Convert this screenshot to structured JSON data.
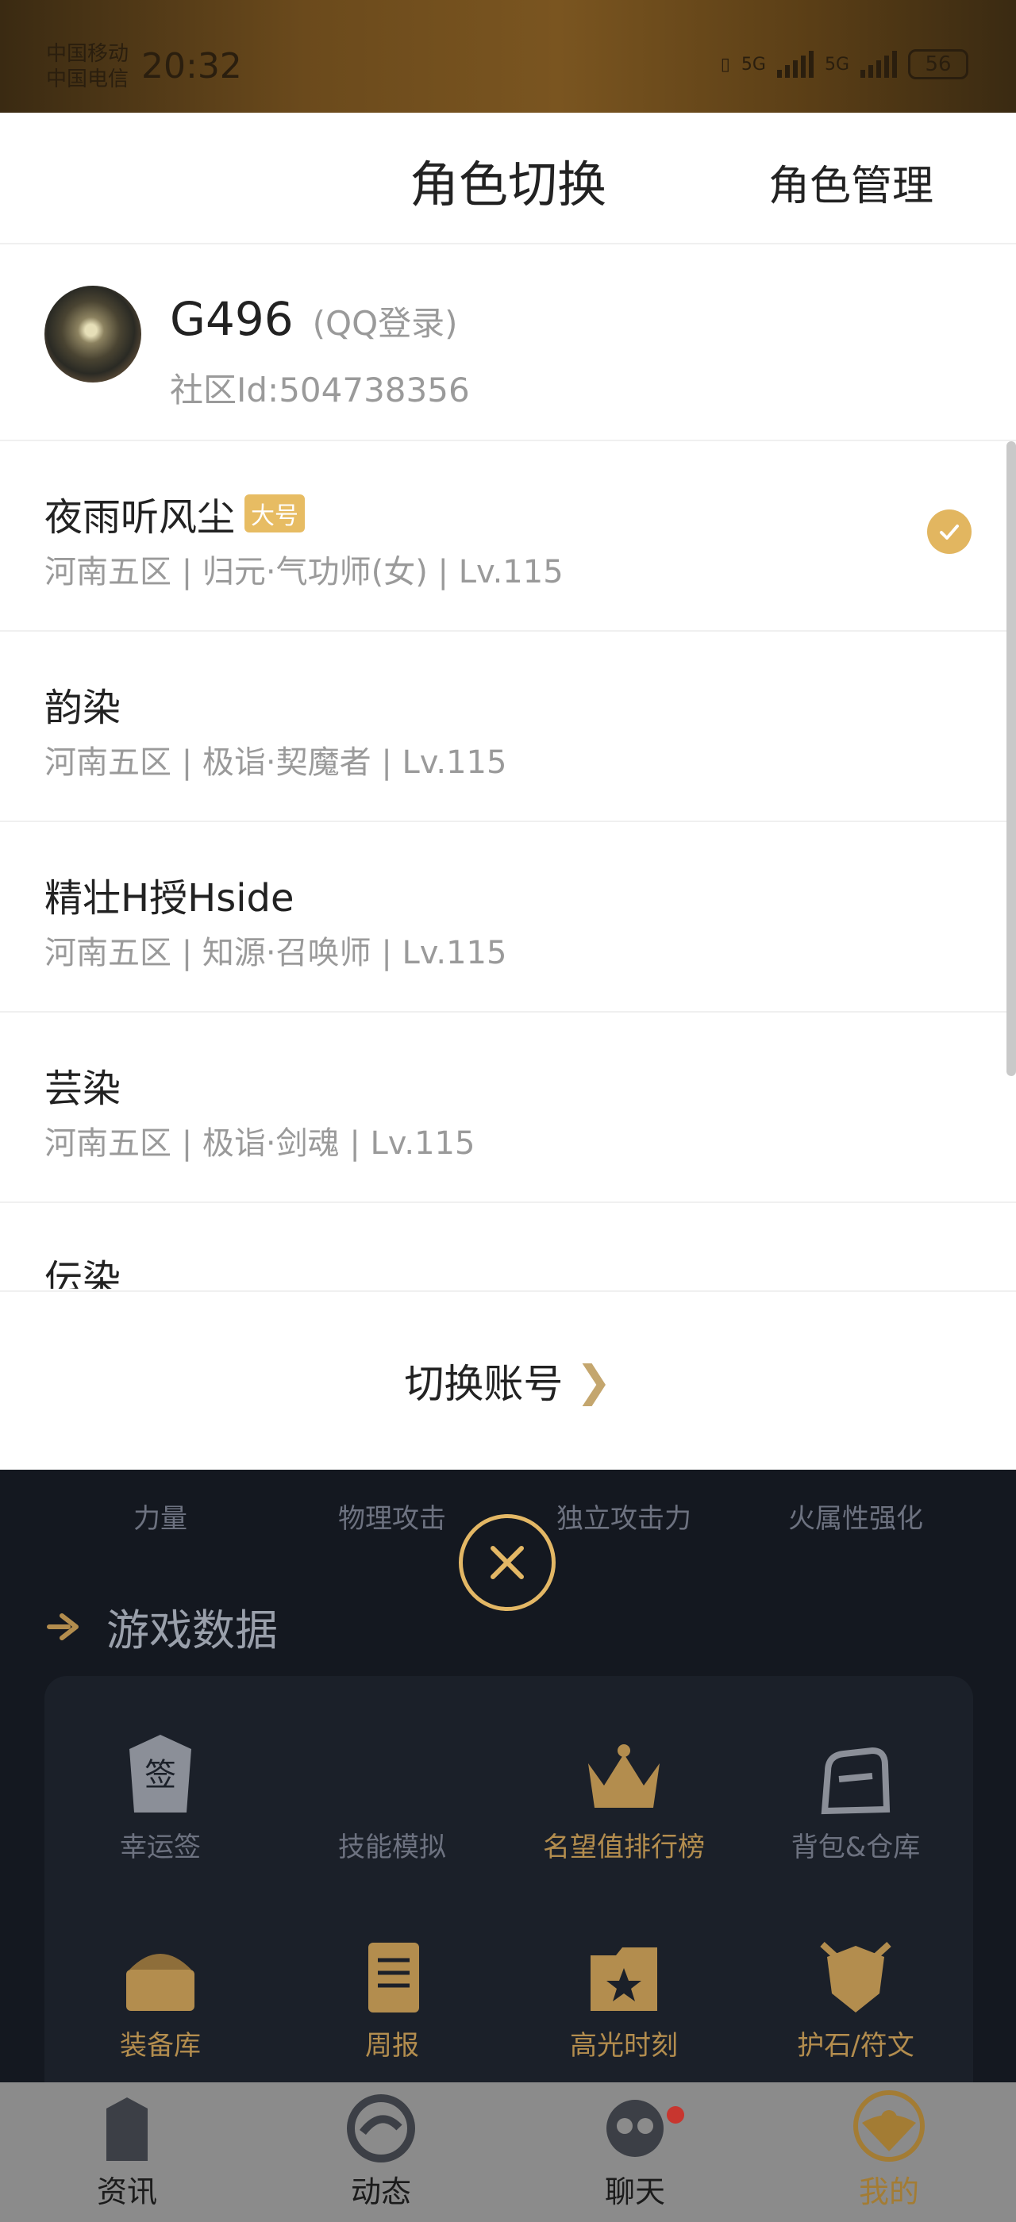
{
  "status": {
    "carrier1": "中国移动",
    "carrier2": "中国电信",
    "time": "20:32",
    "battery": "56",
    "net1": "5G",
    "net2": "5G"
  },
  "sheet": {
    "title": "角色切换",
    "manage_label": "角色管理"
  },
  "account": {
    "name": "G496",
    "login": "(QQ登录)",
    "community_id": "社区Id:504738356"
  },
  "roles": [
    {
      "name": "夜雨听风尘",
      "badge": "大号",
      "meta": "河南五区 | 归元·气功师(女) | Lv.115"
    },
    {
      "name": "韵染",
      "meta": "河南五区 | 极诣·契魔者 | Lv.115"
    },
    {
      "name": "精壮H授Hside",
      "meta": "河南五区 | 知源·召唤师 | Lv.115"
    },
    {
      "name": "芸染",
      "meta": "河南五区 | 极诣·剑魂 | Lv.115"
    },
    {
      "name": "伝染",
      "meta": ""
    }
  ],
  "switch_account": "切换账号",
  "stats": [
    "力量",
    "物理攻击",
    "独立攻击力",
    "火属性强化"
  ],
  "game_data": {
    "title": "游戏数据",
    "tiles": [
      "幸运签",
      "技能模拟",
      "名望值排行榜",
      "背包&仓库",
      "装备库",
      "周报",
      "高光时刻",
      "护石/符文"
    ]
  },
  "nav": [
    "资讯",
    "动态",
    "聊天",
    "我的"
  ],
  "colors": {
    "accent": "#e2b660",
    "badge": "#e7bc63",
    "nav_active": "#a37c34"
  }
}
